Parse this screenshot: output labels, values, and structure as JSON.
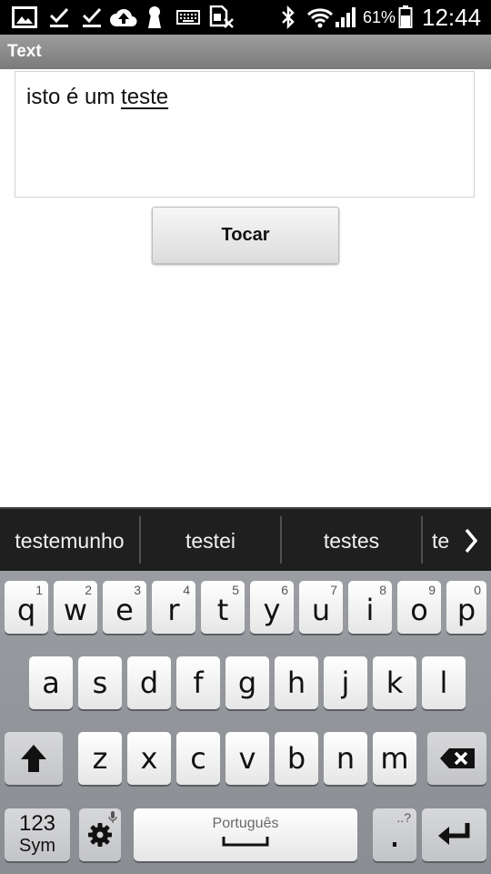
{
  "status_bar": {
    "battery_percent": "61%",
    "time": "12:44",
    "icons": [
      "image-icon",
      "check-icon",
      "check-icon",
      "cloud-upload-icon",
      "keyhole-icon",
      "keyboard-icon",
      "sim-card-x-icon",
      "bluetooth-icon",
      "wifi-icon",
      "signal-icon",
      "battery-icon"
    ]
  },
  "app_bar": {
    "title": "Text"
  },
  "editor": {
    "text_before": "isto é um ",
    "composing_text": "teste"
  },
  "button": {
    "label": "Tocar"
  },
  "suggestions": [
    "testemunho",
    "testei",
    "testes",
    "te"
  ],
  "keyboard": {
    "row1": [
      {
        "key": "q",
        "hint": "1"
      },
      {
        "key": "w",
        "hint": "2"
      },
      {
        "key": "e",
        "hint": "3"
      },
      {
        "key": "r",
        "hint": "4"
      },
      {
        "key": "t",
        "hint": "5"
      },
      {
        "key": "y",
        "hint": "6"
      },
      {
        "key": "u",
        "hint": "7"
      },
      {
        "key": "i",
        "hint": "8"
      },
      {
        "key": "o",
        "hint": "9"
      },
      {
        "key": "p",
        "hint": "0"
      }
    ],
    "row2": [
      "a",
      "s",
      "d",
      "f",
      "g",
      "h",
      "j",
      "k",
      "l"
    ],
    "row3": [
      "z",
      "x",
      "c",
      "v",
      "b",
      "n",
      "m"
    ],
    "sym_line1": "123",
    "sym_line2": "Sym",
    "language": "Português",
    "period": ".",
    "period_hint": "..?"
  },
  "colors": {
    "status_bar": "#000000",
    "title_bar": "#8a8a8a",
    "keyboard_bg": "#909398",
    "suggestion_bg": "#1f1f1f"
  }
}
